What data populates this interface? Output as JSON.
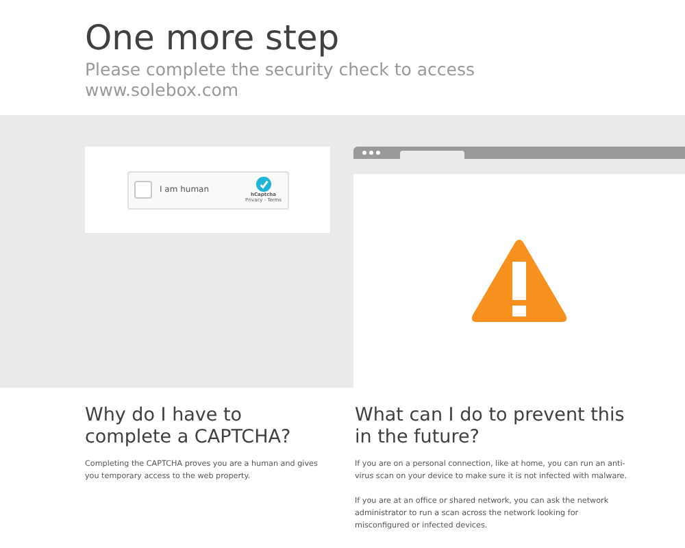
{
  "header": {
    "title": "One more step",
    "subtitle": "Please complete the security check to access www.solebox.com"
  },
  "captcha": {
    "checked": false,
    "label": "I am human",
    "brand": "hCaptcha",
    "links": "Privacy - Terms"
  },
  "sections": [
    {
      "heading": "Why do I have to complete a CAPTCHA?",
      "paragraphs": [
        "Completing the CAPTCHA proves you are a human and gives you temporary access to the web property."
      ]
    },
    {
      "heading": "What can I do to prevent this in the future?",
      "paragraphs": [
        "If you are on a personal connection, like at home, you can run an anti-virus scan on your device to make sure it is not infected with malware.",
        "If you are at an office or shared network, you can ask the network administrator to run a scan across the network looking for misconfigured or infected devices."
      ]
    }
  ]
}
